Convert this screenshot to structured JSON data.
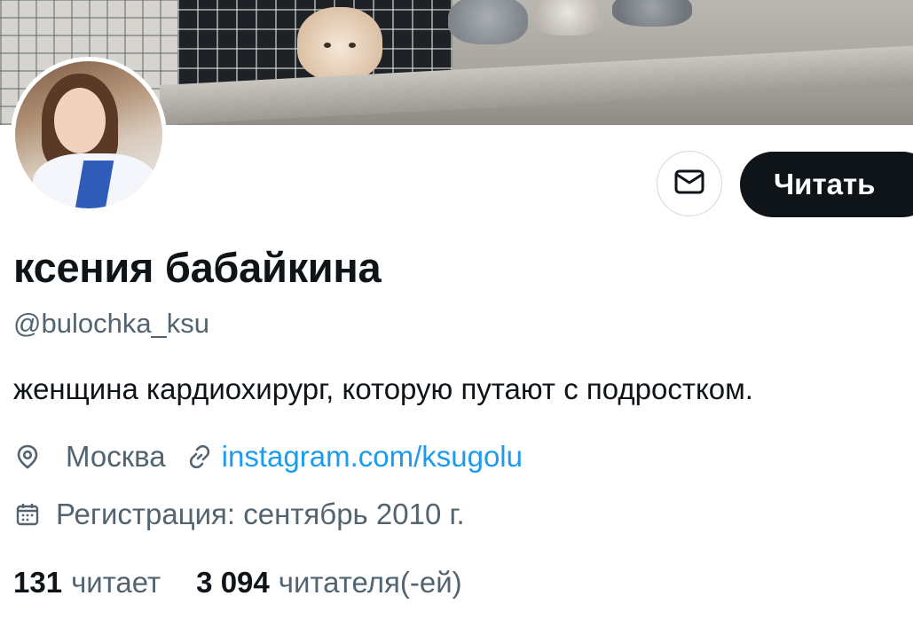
{
  "profile": {
    "display_name": "ксения бабайкина",
    "handle": "@bulochka_ksu",
    "bio": "женщина кардиохирург, которую путают с подростком.",
    "location": "Москва",
    "website": "instagram.com/ksugolu",
    "joined": "Регистрация: сентябрь 2010 г."
  },
  "actions": {
    "message_icon": "envelope-icon",
    "follow_label": "Читать"
  },
  "stats": {
    "following_count": "131",
    "following_label": "читает",
    "followers_count": "3 094",
    "followers_label": "читателя(-ей)"
  },
  "colors": {
    "text_primary": "#0f1419",
    "text_secondary": "#536471",
    "link": "#1d9bf0",
    "button_dark": "#0f1419",
    "border": "#cfd9de"
  },
  "icons": {
    "location": "map-pin-icon",
    "website": "link-icon",
    "joined": "calendar-icon"
  }
}
